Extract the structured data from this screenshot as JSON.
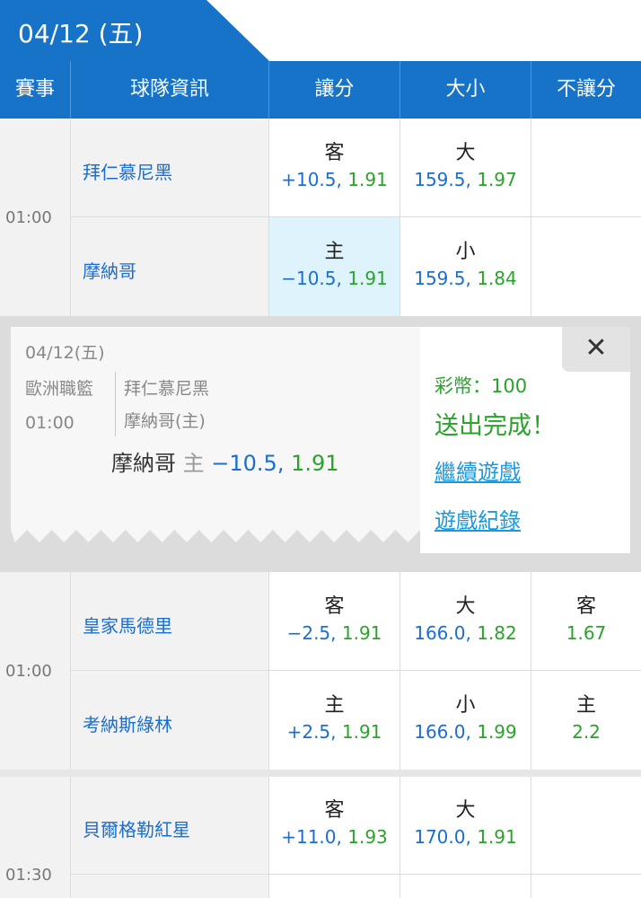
{
  "date_tab": "04/12 (五)",
  "headers": {
    "event": "賽事",
    "team_info": "球隊資訊",
    "handicap": "讓分",
    "over_under": "大小",
    "no_handicap": "不讓分"
  },
  "matches": [
    {
      "time": "01:00",
      "away": {
        "team": "拜仁慕尼黑",
        "hcp_label": "客",
        "hcp_line": "+10.5,",
        "hcp_odds": "1.91",
        "ou_label": "大",
        "ou_line": "159.5,",
        "ou_odds": "1.97"
      },
      "home": {
        "team": "摩納哥",
        "hcp_label": "主",
        "hcp_line": "−10.5,",
        "hcp_odds": "1.91",
        "ou_label": "小",
        "ou_line": "159.5,",
        "ou_odds": "1.84"
      }
    },
    {
      "time": "01:00",
      "away": {
        "team": "皇家馬德里",
        "hcp_label": "客",
        "hcp_line": "−2.5,",
        "hcp_odds": "1.91",
        "ou_label": "大",
        "ou_line": "166.0,",
        "ou_odds": "1.82",
        "ml_label": "客",
        "ml_odds": "1.67"
      },
      "home": {
        "team": "考納斯綠林",
        "hcp_label": "主",
        "hcp_line": "+2.5,",
        "hcp_odds": "1.91",
        "ou_label": "小",
        "ou_line": "166.0,",
        "ou_odds": "1.99",
        "ml_label": "主",
        "ml_odds": "2.2"
      }
    },
    {
      "time": "01:30",
      "away": {
        "team": "貝爾格勒紅星",
        "hcp_label": "客",
        "hcp_line": "+11.0,",
        "hcp_odds": "1.93",
        "ou_label": "大",
        "ou_line": "170.0,",
        "ou_odds": "1.91"
      }
    }
  ],
  "ticket": {
    "date": "04/12(五)",
    "league": "歐洲職籃",
    "time": "01:00",
    "team1": "拜仁慕尼黑",
    "team2": "摩納哥(主)",
    "pick_team": "摩納哥",
    "pick_side": "主",
    "pick_line": "−10.5,",
    "pick_odds": "1.91"
  },
  "result": {
    "coins": "彩幣：100",
    "status": "送出完成！",
    "continue_link": "繼續遊戲",
    "history_link": "遊戲紀錄",
    "close": "✕"
  }
}
